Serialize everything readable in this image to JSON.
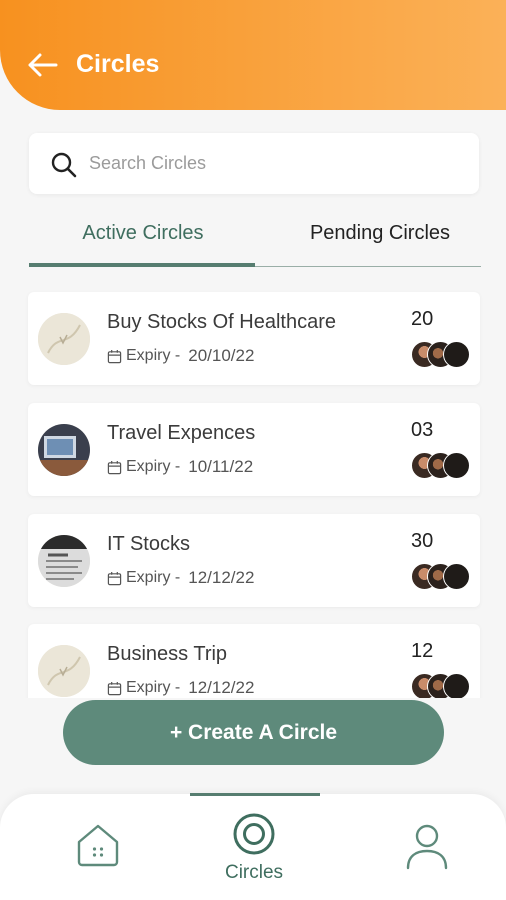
{
  "header": {
    "title": "Circles",
    "back_icon": "arrow-left-icon"
  },
  "search": {
    "placeholder": "Search Circles",
    "value": ""
  },
  "tabs": [
    {
      "label": "Active Circles",
      "active": true
    },
    {
      "label": "Pending Circles",
      "active": false
    }
  ],
  "circles": [
    {
      "title": "Buy Stocks Of Healthcare",
      "expiry_label": "Expiry -",
      "expiry_date": "20/10/22",
      "count": "20"
    },
    {
      "title": "Travel Expences",
      "expiry_label": "Expiry -",
      "expiry_date": "10/11/22",
      "count": "03"
    },
    {
      "title": "IT Stocks",
      "expiry_label": "Expiry -",
      "expiry_date": "12/12/22",
      "count": "30"
    },
    {
      "title": "Business Trip",
      "expiry_label": "Expiry -",
      "expiry_date": "12/12/22",
      "count": "12"
    }
  ],
  "create_button": {
    "label": "+ Create A Circle"
  },
  "bottom_nav": {
    "items": [
      {
        "icon": "home-icon",
        "label": ""
      },
      {
        "icon": "circles-icon",
        "label": "Circles",
        "active": true
      },
      {
        "icon": "profile-icon",
        "label": ""
      }
    ]
  },
  "colors": {
    "header_start": "#f7911f",
    "header_end": "#fbb158",
    "accent_green": "#5e8a7b",
    "tab_active_text": "#3f6e5f"
  }
}
